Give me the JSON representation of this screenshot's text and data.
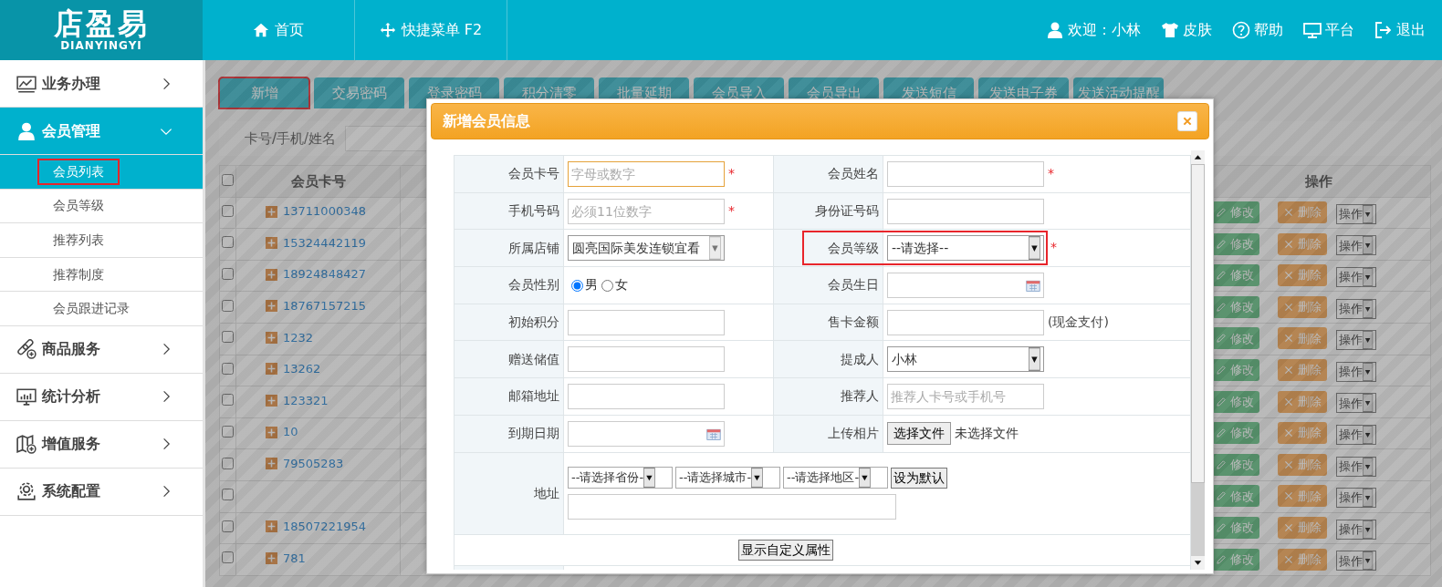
{
  "header": {
    "logo": {
      "title": "店盈易",
      "subtitle": "DIANYINGYI"
    },
    "nav": [
      {
        "label": "首页"
      },
      {
        "label": "快捷菜单 F2"
      }
    ],
    "user_links": [
      {
        "label": "欢迎：小林"
      },
      {
        "label": "皮肤"
      },
      {
        "label": "帮助"
      },
      {
        "label": "平台"
      },
      {
        "label": "退出"
      }
    ]
  },
  "sidebar": {
    "items": [
      {
        "label": "业务办理",
        "expanded": false
      },
      {
        "label": "会员管理",
        "expanded": true,
        "children": [
          {
            "label": "会员列表",
            "selected": true,
            "highlighted": true
          },
          {
            "label": "会员等级",
            "selected": false,
            "highlighted": false
          },
          {
            "label": "推荐列表",
            "selected": false,
            "highlighted": false
          },
          {
            "label": "推荐制度",
            "selected": false,
            "highlighted": false
          },
          {
            "label": "会员跟进记录",
            "selected": false,
            "highlighted": false
          }
        ]
      },
      {
        "label": "商品服务",
        "expanded": false
      },
      {
        "label": "统计分析",
        "expanded": false
      },
      {
        "label": "增值服务",
        "expanded": false
      },
      {
        "label": "系统配置",
        "expanded": false
      }
    ]
  },
  "toolbar": {
    "buttons": [
      {
        "label": "新增",
        "highlighted": true
      },
      {
        "label": "交易密码",
        "highlighted": false
      },
      {
        "label": "登录密码",
        "highlighted": false
      },
      {
        "label": "积分清零",
        "highlighted": false
      },
      {
        "label": "批量延期",
        "highlighted": false
      },
      {
        "label": "会员导入",
        "highlighted": false
      },
      {
        "label": "会员导出",
        "highlighted": false
      },
      {
        "label": "发送短信",
        "highlighted": false
      },
      {
        "label": "发送电子券",
        "highlighted": false
      },
      {
        "label": "发送活动提醒",
        "highlighted": false
      }
    ]
  },
  "search": {
    "label": "卡号/手机/姓名"
  },
  "table": {
    "select_all": {
      "checked": false
    },
    "columns": [
      {
        "label": "会员卡号"
      },
      {
        "label": "操作"
      }
    ],
    "rows": [
      {
        "card_no": "13711000348",
        "checked": false,
        "edit": "修改",
        "delete": "删除",
        "menu": "操作"
      },
      {
        "card_no": "15324442119",
        "checked": false,
        "edit": "修改",
        "delete": "删除",
        "menu": "操作"
      },
      {
        "card_no": "18924848427",
        "checked": false,
        "edit": "修改",
        "delete": "删除",
        "menu": "操作"
      },
      {
        "card_no": "18767157215",
        "checked": false,
        "edit": "修改",
        "delete": "删除",
        "menu": "操作"
      },
      {
        "card_no": "1232",
        "checked": false,
        "edit": "修改",
        "delete": "删除",
        "menu": "操作"
      },
      {
        "card_no": "13262",
        "checked": false,
        "edit": "修改",
        "delete": "删除",
        "menu": "操作"
      },
      {
        "card_no": "123321",
        "checked": false,
        "edit": "修改",
        "delete": "删除",
        "menu": "操作"
      },
      {
        "card_no": "10",
        "checked": false,
        "edit": "修改",
        "delete": "删除",
        "menu": "操作"
      },
      {
        "card_no": "79505283",
        "checked": false,
        "edit": "修改",
        "delete": "删除",
        "menu": "操作"
      },
      {
        "checked": false,
        "edit": "修改",
        "delete": "删除",
        "menu": "操作"
      },
      {
        "card_no": "18507221954",
        "checked": false,
        "edit": "修改",
        "delete": "删除",
        "menu": "操作"
      },
      {
        "card_no": "781",
        "checked": false,
        "edit": "修改",
        "delete": "删除",
        "menu": "操作"
      }
    ]
  },
  "modal": {
    "title": "新增会员信息",
    "rows": [
      [
        {
          "label": "会员卡号",
          "kind": "text",
          "placeholder": "字母或数字",
          "required_mark": "*",
          "focused": true
        },
        {
          "label": "会员姓名",
          "kind": "text",
          "required_mark": "*",
          "focused": false
        }
      ],
      [
        {
          "label": "手机号码",
          "kind": "text",
          "placeholder": "必须11位数字",
          "required_mark": "*",
          "focused": false
        },
        {
          "label": "身份证号码",
          "kind": "text",
          "focused": false
        }
      ],
      [
        {
          "label": "所属店铺",
          "kind": "select",
          "value": "圆亮国际美发连锁宜看",
          "disabled": true,
          "highlighted": false
        },
        {
          "label": "会员等级",
          "kind": "select",
          "value": "--请选择--",
          "disabled": false,
          "highlighted": true,
          "required_mark": "*"
        }
      ],
      [
        {
          "label": "会员性别",
          "kind": "radio",
          "options": [
            {
              "label": "男",
              "selected": true
            },
            {
              "label": "女",
              "selected": false
            }
          ]
        },
        {
          "label": "会员生日",
          "kind": "date"
        }
      ],
      [
        {
          "label": "初始积分",
          "kind": "text",
          "focused": false
        },
        {
          "label": "售卡金额",
          "kind": "text",
          "note": "(现金支付)",
          "focused": false
        }
      ],
      [
        {
          "label": "赠送储值",
          "kind": "text",
          "focused": false
        },
        {
          "label": "提成人",
          "kind": "select",
          "value": "小林",
          "disabled": false,
          "highlighted": false
        }
      ],
      [
        {
          "label": "邮箱地址",
          "kind": "text",
          "focused": false
        },
        {
          "label": "推荐人",
          "kind": "text",
          "placeholder": "推荐人卡号或手机号",
          "focused": false
        }
      ],
      [
        {
          "label": "到期日期",
          "kind": "date"
        },
        {
          "label": "上传相片",
          "kind": "file",
          "button": "选择文件",
          "status": "未选择文件"
        }
      ]
    ],
    "address": {
      "label": "地址",
      "selects": [
        "--请选择省份-",
        "--请选择城市-",
        "--请选择地区-"
      ],
      "default_button": "设为默认"
    },
    "custom_button": "显示自定义属性"
  }
}
